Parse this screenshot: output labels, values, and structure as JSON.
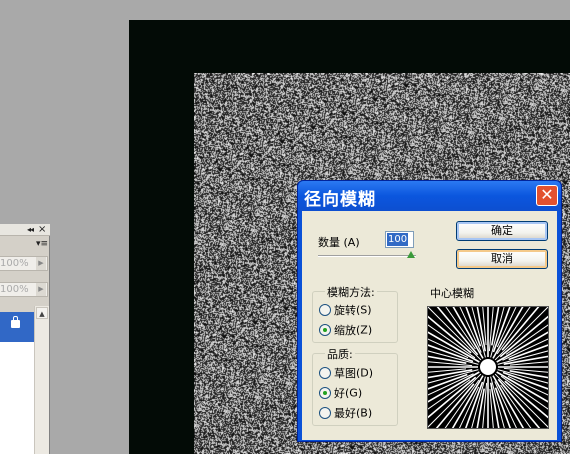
{
  "left_panel": {
    "collapse_icon": "double-left-arrow",
    "close_icon": "close",
    "menu_icon": "panel-menu",
    "opacity": "100%",
    "fill": "100%",
    "lock_icon": "lock"
  },
  "dialog": {
    "title": "径向模糊",
    "close_glyph": "✕",
    "amount_label": "数量",
    "amount_mnemonic": "(A)",
    "amount_value": "100",
    "ok_label": "确定",
    "cancel_label": "取消",
    "method_legend": "模糊方法:",
    "method_options": [
      {
        "label": "旋转",
        "mnemonic": "(S)",
        "checked": false
      },
      {
        "label": "缩放",
        "mnemonic": "(Z)",
        "checked": true
      }
    ],
    "quality_legend": "品质:",
    "quality_options": [
      {
        "label": "草图",
        "mnemonic": "(D)",
        "checked": false
      },
      {
        "label": "好",
        "mnemonic": "(G)",
        "checked": true
      },
      {
        "label": "最好",
        "mnemonic": "(B)",
        "checked": false
      }
    ],
    "center_label": "中心模糊"
  },
  "colors": {
    "canvas_border": "#030b06",
    "titlebar": "#0b56de",
    "dialog_body": "#ece9d8",
    "close_button": "#e2512f",
    "selection": "#316ac5"
  }
}
